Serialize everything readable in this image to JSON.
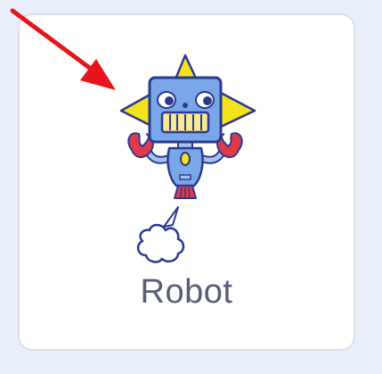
{
  "sprite": {
    "name": "Robot",
    "icon": "robot-costume-icon",
    "secondary_icon": "steam-puff-icon"
  },
  "annotation": {
    "icon": "red-arrow-icon",
    "color": "#e8141b"
  },
  "colors": {
    "background": "#e8effb",
    "card_border": "#dcdfe6",
    "label": "#575e75",
    "robot_head": "#7aa7e8",
    "robot_outline": "#2b3a8f",
    "robot_star": "#f2e31c",
    "robot_accent": "#e23a49"
  }
}
